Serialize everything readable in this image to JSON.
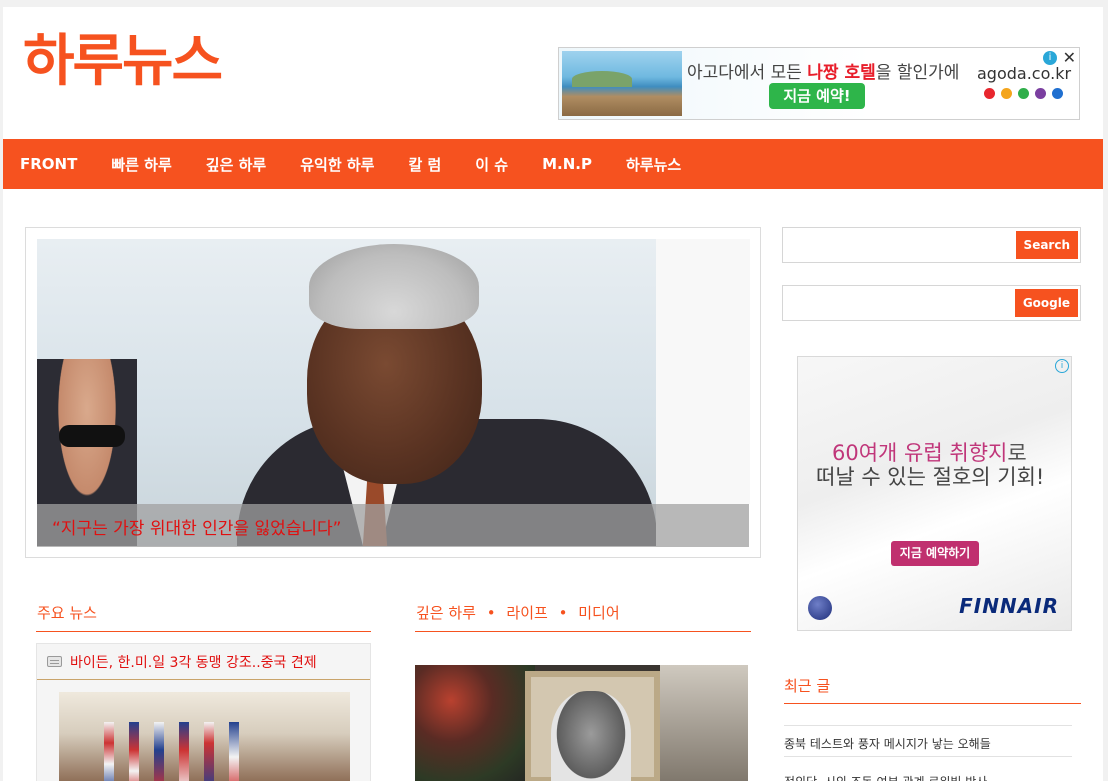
{
  "site": {
    "logo": "하루뉴스"
  },
  "top_ad": {
    "text_before": "아고다에서 모든 ",
    "text_highlight": "나짱 호텔",
    "text_after": "을 할인가에",
    "cta": "지금 예약!",
    "brand": "agoda.co.kr",
    "info_icon": "info-icon",
    "close_icon": "close-icon",
    "dot_colors": [
      "#e8262e",
      "#f4a51c",
      "#2fae4a",
      "#7b3fa0",
      "#1f6fd0"
    ]
  },
  "nav": {
    "items": [
      "FRONT",
      "빠른 하루",
      "깊은 하루",
      "유익한 하루",
      "칼 럼",
      "이 슈",
      "M.N.P",
      "하루뉴스"
    ]
  },
  "slider": {
    "caption": "“지구는 가장 위대한 인간을 잃었습니다”"
  },
  "sidebar": {
    "search_button": "Search",
    "google_button": "Google",
    "ad": {
      "line1_a": "60여",
      "line1_b": "개 ",
      "line1_c": "유럽 ",
      "line1_d": "취향지",
      "line1_e": "로",
      "line2": "떠날 수 있는 절호의 기회!",
      "cta": "지금 예약하기",
      "brand": "FINNAIR",
      "info_icon": "info-icon"
    },
    "recent_title": "최근 글",
    "recent_posts": [
      "종북 테스트와 풍자 메시지가 낳는 오해들",
      "정의당, 시의 조돈 여부 관계 르워빌 박사"
    ]
  },
  "main_news": {
    "title": "주요 뉴스",
    "headline": "바이든, 한.미.일 3각 동맹 강조..중국 견제"
  },
  "deep": {
    "title_parts": [
      "깊은 하루",
      "라이프",
      "미디어"
    ],
    "separator": "•"
  },
  "colors": {
    "accent": "#f6521f",
    "headline": "#e01010"
  }
}
